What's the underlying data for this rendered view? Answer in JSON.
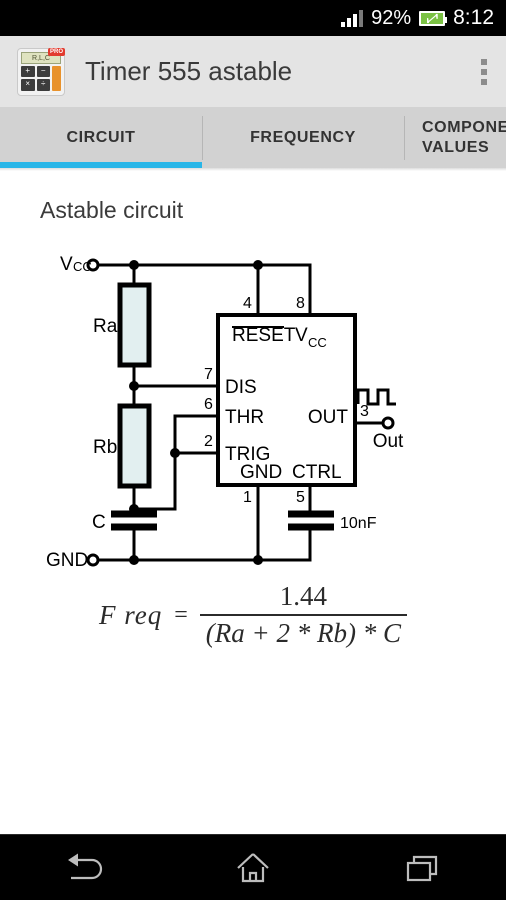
{
  "status_bar": {
    "battery_percent": "92%",
    "time": "8:12",
    "signal_icon": "signal-bars-icon",
    "battery_icon": "battery-charging-icon"
  },
  "action_bar": {
    "title": "Timer 555 astable",
    "app_icon": {
      "name": "rlc-calculator-icon",
      "display_text": "R,L,C",
      "badge": "PRO",
      "keys": [
        "+",
        "−",
        "×",
        "÷"
      ]
    },
    "overflow_icon": "overflow-menu-icon"
  },
  "tabs": {
    "items": [
      {
        "label": "CIRCUIT",
        "active": true
      },
      {
        "label": "FREQUENCY",
        "active": false
      },
      {
        "label": "COMPONENT\nVALUES",
        "active": false
      }
    ],
    "active_indicator_color": "#29b6e8"
  },
  "content": {
    "heading": "Astable circuit",
    "circuit": {
      "title": "555 astable circuit schematic",
      "rails": {
        "top": "V",
        "top_sub": "CC",
        "bottom": "GND"
      },
      "components": [
        {
          "name": "Ra",
          "label": "Ra",
          "type": "resistor"
        },
        {
          "name": "Rb",
          "label": "Rb",
          "type": "resistor"
        },
        {
          "name": "C",
          "label": "C",
          "type": "capacitor"
        },
        {
          "name": "Cctrl",
          "label": "10nF",
          "type": "capacitor"
        }
      ],
      "ic": {
        "name": "555-timer-ic",
        "pins": [
          {
            "number": "4",
            "label": "RESET",
            "overline": true
          },
          {
            "number": "8",
            "label": "V",
            "sub": "CC"
          },
          {
            "number": "7",
            "label": "DIS"
          },
          {
            "number": "6",
            "label": "THR"
          },
          {
            "number": "2",
            "label": "TRIG"
          },
          {
            "number": "3",
            "label": "OUT"
          },
          {
            "number": "1",
            "label": "GND"
          },
          {
            "number": "5",
            "label": "CTRL"
          }
        ]
      },
      "output": {
        "terminal_label": "Out",
        "waveform": "square-wave-icon",
        "pin": "3"
      },
      "colors": {
        "wire": "#000000",
        "resistor_fill": "#e2eff0",
        "background": "#ffffff"
      }
    },
    "formula": {
      "lhs": "F req",
      "equals": "=",
      "numerator": "1.44",
      "denominator": "(Ra + 2 * Rb) * C"
    }
  },
  "nav_bar": {
    "back_icon": "back-icon",
    "home_icon": "home-icon",
    "recents_icon": "recents-icon"
  }
}
